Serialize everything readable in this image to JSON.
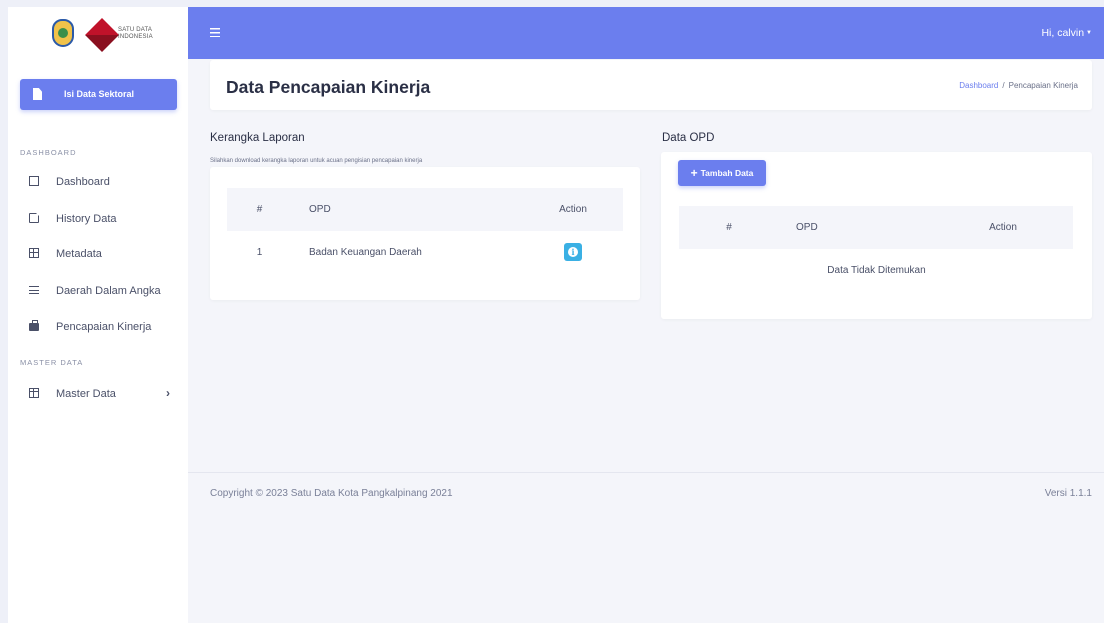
{
  "sidebar": {
    "logo_text": "SATU DATA INDONESIA",
    "primary_button": "Isi Data Sektoral",
    "sections": [
      {
        "heading": "DASHBOARD",
        "items": [
          {
            "label": "Dashboard",
            "icon": "square-icon"
          },
          {
            "label": "History Data",
            "icon": "file-icon"
          },
          {
            "label": "Metadata",
            "icon": "grid-icon"
          },
          {
            "label": "Daerah Dalam Angka",
            "icon": "list-icon"
          },
          {
            "label": "Pencapaian Kinerja",
            "icon": "briefcase-icon"
          }
        ]
      },
      {
        "heading": "MASTER DATA",
        "items": [
          {
            "label": "Master Data",
            "icon": "table-icon",
            "has_submenu": true
          }
        ]
      }
    ]
  },
  "topbar": {
    "user_greeting": "Hi, calvin"
  },
  "page": {
    "title": "Data Pencapaian Kinerja",
    "breadcrumb": {
      "home": "Dashboard",
      "current": "Pencapaian Kinerja"
    }
  },
  "kerangka": {
    "title": "Kerangka Laporan",
    "subtitle": "Silahkan download kerangka laporan untuk acuan pengisian pencapaian kinerja",
    "columns": [
      "#",
      "OPD",
      "Action"
    ],
    "rows": [
      {
        "no": "1",
        "opd": "Badan Keuangan Daerah"
      }
    ]
  },
  "opd": {
    "title": "Data OPD",
    "add_button": "Tambah Data",
    "columns": [
      "#",
      "OPD",
      "Action"
    ],
    "empty_message": "Data Tidak Ditemukan"
  },
  "footer": {
    "copyright": "Copyright © 2023 Satu Data Kota Pangkalpinang 2021",
    "version": "Versi 1.1.1"
  },
  "colors": {
    "primary": "#6b7eee",
    "info": "#3ab0e4",
    "background": "#f4f5fa"
  }
}
